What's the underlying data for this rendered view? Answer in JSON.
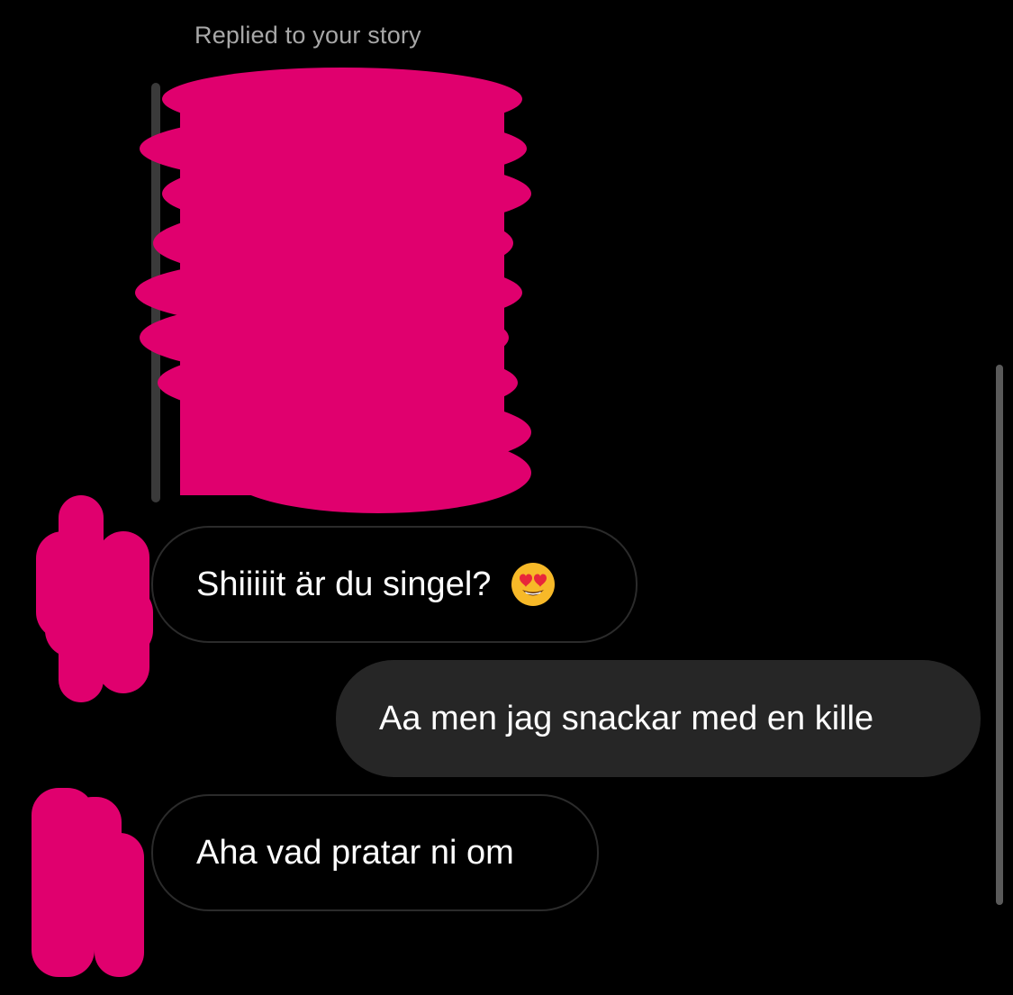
{
  "header": {
    "replied_label": "Replied to your story"
  },
  "colors": {
    "background": "#000000",
    "redaction_marker": "#e0006e",
    "incoming_border": "#2b2b2b",
    "outgoing_fill": "#262626",
    "muted_text": "#a8a8a8"
  },
  "messages": [
    {
      "direction": "incoming",
      "text": "Shiiiiit är du singel?",
      "emoji": "smiling-face-with-heart-eyes-icon"
    },
    {
      "direction": "outgoing",
      "text": "Aa men jag snackar med en kille"
    },
    {
      "direction": "incoming",
      "text": "Aha vad pratar ni om"
    }
  ]
}
